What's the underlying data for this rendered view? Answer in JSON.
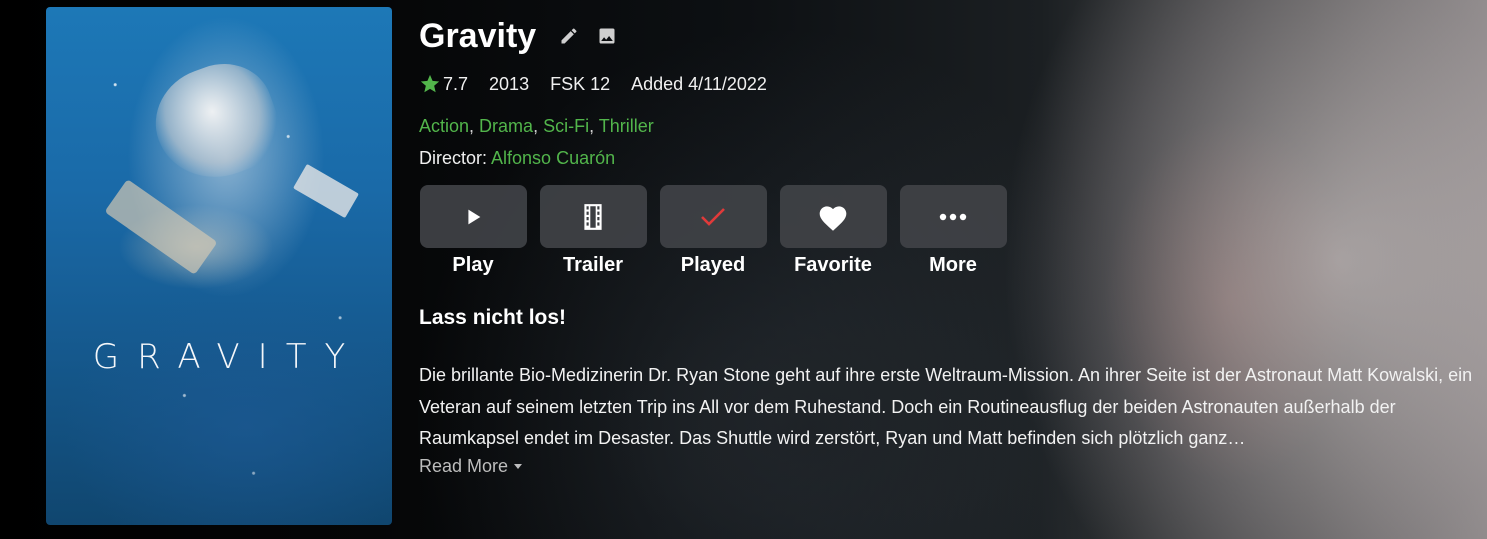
{
  "poster": {
    "title_text": "GRAVITY"
  },
  "item": {
    "title": "Gravity",
    "icons": [
      "edit-icon",
      "image-icon"
    ],
    "rating": "7.7",
    "year": "2013",
    "official_rating": "FSK 12",
    "added": "Added 4/11/2022",
    "genres": [
      "Action",
      "Drama",
      "Sci-Fi",
      "Thriller"
    ],
    "director_label": "Director:",
    "director": "Alfonso Cuarón",
    "tagline": "Lass nicht los!",
    "overview": "Die brillante Bio-Medizinerin Dr. Ryan Stone geht auf ihre erste Weltraum-Mission. An ihrer Seite ist der Astronaut Matt Kowalski, ein Veteran auf seinem letzten Trip ins All vor dem Ruhestand. Doch ein Routineausflug der beiden Astronauten außerhalb der Raumkapsel endet im Desaster. Das Shuttle wird zerstört, Ryan und Matt befinden sich plötzlich ganz…",
    "read_more": "Read More"
  },
  "actions": [
    {
      "label": "Play",
      "icon": "play-icon"
    },
    {
      "label": "Trailer",
      "icon": "film-icon"
    },
    {
      "label": "Played",
      "icon": "check-icon"
    },
    {
      "label": "Favorite",
      "icon": "heart-icon"
    },
    {
      "label": "More",
      "icon": "more-icon"
    }
  ],
  "colors": {
    "accent_green": "#52b54b",
    "played_check": "#e03a3a",
    "star": "#52b54b",
    "button_bg": "#404246"
  }
}
